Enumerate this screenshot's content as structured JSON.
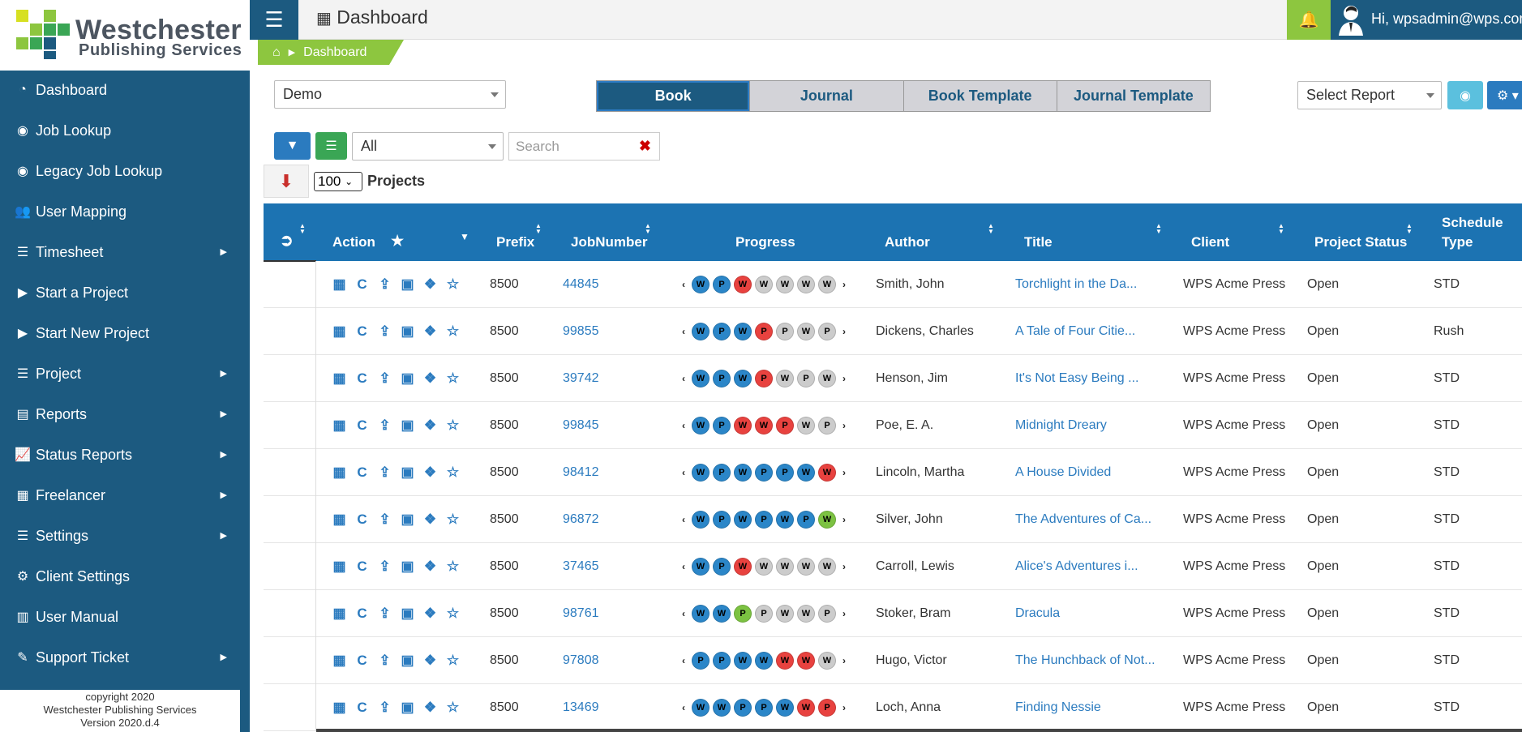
{
  "logo": {
    "line1": "Westchester",
    "line2": "Publishing Services"
  },
  "sidebar": {
    "items": [
      {
        "label": "Dashboard",
        "icon": "dashboard-icon",
        "glyph": "◔",
        "submenu": false
      },
      {
        "label": "Job Lookup",
        "icon": "eye-icon",
        "glyph": "◉",
        "submenu": false
      },
      {
        "label": "Legacy Job Lookup",
        "icon": "eye-icon",
        "glyph": "◉",
        "submenu": false
      },
      {
        "label": "User Mapping",
        "icon": "users-icon",
        "glyph": "👥",
        "submenu": false
      },
      {
        "label": "Timesheet",
        "icon": "list-icon",
        "glyph": "☰",
        "submenu": true
      },
      {
        "label": "Start a Project",
        "icon": "play-circle-icon",
        "glyph": "▶",
        "submenu": false
      },
      {
        "label": "Start New Project",
        "icon": "play-circle-icon",
        "glyph": "▶",
        "submenu": false
      },
      {
        "label": "Project",
        "icon": "list-icon",
        "glyph": "☰",
        "submenu": true
      },
      {
        "label": "Reports",
        "icon": "file-icon",
        "glyph": "▤",
        "submenu": true
      },
      {
        "label": "Status Reports",
        "icon": "line-chart-icon",
        "glyph": "📈",
        "submenu": true
      },
      {
        "label": "Freelancer",
        "icon": "building-icon",
        "glyph": "▦",
        "submenu": true
      },
      {
        "label": "Settings",
        "icon": "list-icon",
        "glyph": "☰",
        "submenu": true
      },
      {
        "label": "Client Settings",
        "icon": "gear-icon",
        "glyph": "⚙",
        "submenu": false
      },
      {
        "label": "User Manual",
        "icon": "book-icon",
        "glyph": "▥",
        "submenu": false
      },
      {
        "label": "Support Ticket",
        "icon": "ticket-icon",
        "glyph": "✎",
        "submenu": true
      }
    ],
    "footer": {
      "line1": "copyright 2020",
      "line2": "Westchester Publishing Services",
      "line3": "Version 2020.d.4"
    }
  },
  "header": {
    "title": "Dashboard",
    "user": "Hi, wpsadmin@wps.com"
  },
  "breadcrumb": {
    "label": "Dashboard"
  },
  "controls": {
    "client_select": "Demo",
    "tabs": [
      {
        "label": "Book",
        "active": true
      },
      {
        "label": "Journal",
        "active": false
      },
      {
        "label": "Book Template",
        "active": false
      },
      {
        "label": "Journal Template",
        "active": false
      }
    ],
    "report_select": "Select Report",
    "filter_select": "All",
    "search_placeholder": "Search",
    "page_size": "100",
    "page_size_label": "Projects"
  },
  "table": {
    "headers": {
      "action": "Action",
      "prefix": "Prefix",
      "jobnumber": "JobNumber",
      "progress": "Progress",
      "author": "Author",
      "title": "Title",
      "client": "Client",
      "status": "Project Status",
      "schedule1": "Schedule",
      "schedule2": "Type"
    },
    "colors": {
      "blue": "#2b86c8",
      "red": "#e8423f",
      "gray": "#cccccc",
      "green": "#7cc242"
    },
    "rows": [
      {
        "prefix": "8500",
        "job": "44845",
        "progress": [
          [
            "W",
            "blue"
          ],
          [
            "P",
            "blue"
          ],
          [
            "W",
            "red"
          ],
          [
            "W",
            "gray"
          ],
          [
            "W",
            "gray"
          ],
          [
            "W",
            "gray"
          ],
          [
            "W",
            "gray"
          ]
        ],
        "author": "Smith, John",
        "title": "Torchlight in the Da...",
        "client": "WPS Acme Press",
        "status": "Open",
        "schedule": "STD"
      },
      {
        "prefix": "8500",
        "job": "99855",
        "progress": [
          [
            "W",
            "blue"
          ],
          [
            "P",
            "blue"
          ],
          [
            "W",
            "blue"
          ],
          [
            "P",
            "red"
          ],
          [
            "P",
            "gray"
          ],
          [
            "W",
            "gray"
          ],
          [
            "P",
            "gray"
          ]
        ],
        "author": "Dickens, Charles",
        "title": "A Tale of Four Citie...",
        "client": "WPS Acme Press",
        "status": "Open",
        "schedule": "Rush"
      },
      {
        "prefix": "8500",
        "job": "39742",
        "progress": [
          [
            "W",
            "blue"
          ],
          [
            "P",
            "blue"
          ],
          [
            "W",
            "blue"
          ],
          [
            "P",
            "red"
          ],
          [
            "W",
            "gray"
          ],
          [
            "P",
            "gray"
          ],
          [
            "W",
            "gray"
          ]
        ],
        "author": "Henson, Jim",
        "title": "It's Not Easy Being ...",
        "client": "WPS Acme Press",
        "status": "Open",
        "schedule": "STD"
      },
      {
        "prefix": "8500",
        "job": "99845",
        "progress": [
          [
            "W",
            "blue"
          ],
          [
            "P",
            "blue"
          ],
          [
            "W",
            "red"
          ],
          [
            "W",
            "red"
          ],
          [
            "P",
            "red"
          ],
          [
            "W",
            "gray"
          ],
          [
            "P",
            "gray"
          ]
        ],
        "author": "Poe, E. A.",
        "title": "Midnight Dreary",
        "client": "WPS Acme Press",
        "status": "Open",
        "schedule": "STD"
      },
      {
        "prefix": "8500",
        "job": "98412",
        "progress": [
          [
            "W",
            "blue"
          ],
          [
            "P",
            "blue"
          ],
          [
            "W",
            "blue"
          ],
          [
            "P",
            "blue"
          ],
          [
            "P",
            "blue"
          ],
          [
            "W",
            "blue"
          ],
          [
            "W",
            "red"
          ]
        ],
        "author": "Lincoln, Martha",
        "title": "A House Divided",
        "client": "WPS Acme Press",
        "status": "Open",
        "schedule": "STD"
      },
      {
        "prefix": "8500",
        "job": "96872",
        "progress": [
          [
            "W",
            "blue"
          ],
          [
            "P",
            "blue"
          ],
          [
            "W",
            "blue"
          ],
          [
            "P",
            "blue"
          ],
          [
            "W",
            "blue"
          ],
          [
            "P",
            "blue"
          ],
          [
            "W",
            "green"
          ]
        ],
        "author": "Silver, John",
        "title": "The Adventures of Ca...",
        "client": "WPS Acme Press",
        "status": "Open",
        "schedule": "STD"
      },
      {
        "prefix": "8500",
        "job": "37465",
        "progress": [
          [
            "W",
            "blue"
          ],
          [
            "P",
            "blue"
          ],
          [
            "W",
            "red"
          ],
          [
            "W",
            "gray"
          ],
          [
            "W",
            "gray"
          ],
          [
            "W",
            "gray"
          ],
          [
            "W",
            "gray"
          ]
        ],
        "author": "Carroll, Lewis",
        "title": "Alice's Adventures i...",
        "client": "WPS Acme Press",
        "status": "Open",
        "schedule": "STD"
      },
      {
        "prefix": "8500",
        "job": "98761",
        "progress": [
          [
            "W",
            "blue"
          ],
          [
            "W",
            "blue"
          ],
          [
            "P",
            "green"
          ],
          [
            "P",
            "gray"
          ],
          [
            "W",
            "gray"
          ],
          [
            "W",
            "gray"
          ],
          [
            "P",
            "gray"
          ]
        ],
        "author": "Stoker, Bram",
        "title": "Dracula",
        "client": "WPS Acme Press",
        "status": "Open",
        "schedule": "STD"
      },
      {
        "prefix": "8500",
        "job": "97808",
        "progress": [
          [
            "P",
            "blue"
          ],
          [
            "P",
            "blue"
          ],
          [
            "W",
            "blue"
          ],
          [
            "W",
            "blue"
          ],
          [
            "W",
            "red"
          ],
          [
            "W",
            "red"
          ],
          [
            "W",
            "gray"
          ]
        ],
        "author": "Hugo, Victor",
        "title": "The Hunchback of Not...",
        "client": "WPS Acme Press",
        "status": "Open",
        "schedule": "STD"
      },
      {
        "prefix": "8500",
        "job": "13469",
        "progress": [
          [
            "W",
            "blue"
          ],
          [
            "W",
            "blue"
          ],
          [
            "P",
            "blue"
          ],
          [
            "P",
            "blue"
          ],
          [
            "W",
            "blue"
          ],
          [
            "W",
            "red"
          ],
          [
            "P",
            "red"
          ]
        ],
        "author": "Loch, Anna",
        "title": "Finding Nessie",
        "client": "WPS Acme Press",
        "status": "Open",
        "schedule": "STD"
      }
    ]
  }
}
